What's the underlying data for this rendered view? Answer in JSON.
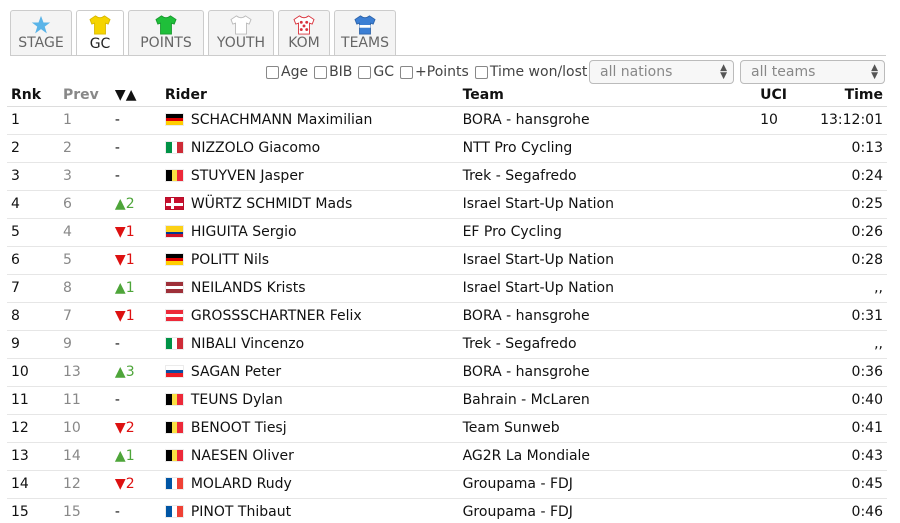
{
  "tabs": [
    {
      "label": "STAGE",
      "icon": "star-icon",
      "color": "#5ab4e8",
      "active": false
    },
    {
      "label": "GC",
      "icon": "yellow-jersey-icon",
      "color": "#f5d400",
      "active": true
    },
    {
      "label": "POINTS",
      "icon": "green-jersey-icon",
      "color": "#1fbf3a",
      "active": false
    },
    {
      "label": "YOUTH",
      "icon": "white-jersey-icon",
      "color": "#ffffff",
      "active": false
    },
    {
      "label": "KOM",
      "icon": "polka-dot-jersey-icon",
      "color": "#d9323c",
      "active": false
    },
    {
      "label": "TEAMS",
      "icon": "team-jersey-icon",
      "color": "#3c7fd4",
      "active": false
    }
  ],
  "filters": {
    "checkboxes": [
      "Age",
      "BIB",
      "GC",
      "+Points",
      "Time won/lost"
    ],
    "nations_select": "all nations",
    "teams_select": "all teams"
  },
  "table": {
    "headers": {
      "rnk": "Rnk",
      "prev": "Prev",
      "diff": "▼▲",
      "rider": "Rider",
      "team": "Team",
      "uci": "UCI",
      "time": "Time"
    },
    "rows": [
      {
        "rnk": "1",
        "prev": "1",
        "diff": "-",
        "dir": "",
        "flag": "de",
        "rider": "SCHACHMANN Maximilian",
        "team": "BORA - hansgrohe",
        "uci": "10",
        "time": "13:12:01"
      },
      {
        "rnk": "2",
        "prev": "2",
        "diff": "-",
        "dir": "",
        "flag": "it",
        "rider": "NIZZOLO Giacomo",
        "team": "NTT Pro Cycling",
        "uci": "",
        "time": "0:13"
      },
      {
        "rnk": "3",
        "prev": "3",
        "diff": "-",
        "dir": "",
        "flag": "be",
        "rider": "STUYVEN Jasper",
        "team": "Trek - Segafredo",
        "uci": "",
        "time": "0:24"
      },
      {
        "rnk": "4",
        "prev": "6",
        "diff": "▲2",
        "dir": "up",
        "flag": "dk",
        "rider": "WÜRTZ SCHMIDT Mads",
        "team": "Israel Start-Up Nation",
        "uci": "",
        "time": "0:25"
      },
      {
        "rnk": "5",
        "prev": "4",
        "diff": "▼1",
        "dir": "down",
        "flag": "co",
        "rider": "HIGUITA Sergio",
        "team": "EF Pro Cycling",
        "uci": "",
        "time": "0:26"
      },
      {
        "rnk": "6",
        "prev": "5",
        "diff": "▼1",
        "dir": "down",
        "flag": "de",
        "rider": "POLITT Nils",
        "team": "Israel Start-Up Nation",
        "uci": "",
        "time": "0:28"
      },
      {
        "rnk": "7",
        "prev": "8",
        "diff": "▲1",
        "dir": "up",
        "flag": "lv",
        "rider": "NEILANDS Krists",
        "team": "Israel Start-Up Nation",
        "uci": "",
        "time": ",,"
      },
      {
        "rnk": "8",
        "prev": "7",
        "diff": "▼1",
        "dir": "down",
        "flag": "at",
        "rider": "GROSSSCHARTNER Felix",
        "team": "BORA - hansgrohe",
        "uci": "",
        "time": "0:31"
      },
      {
        "rnk": "9",
        "prev": "9",
        "diff": "-",
        "dir": "",
        "flag": "it",
        "rider": "NIBALI Vincenzo",
        "team": "Trek - Segafredo",
        "uci": "",
        "time": ",,"
      },
      {
        "rnk": "10",
        "prev": "13",
        "diff": "▲3",
        "dir": "up",
        "flag": "sk",
        "rider": "SAGAN Peter",
        "team": "BORA - hansgrohe",
        "uci": "",
        "time": "0:36"
      },
      {
        "rnk": "11",
        "prev": "11",
        "diff": "-",
        "dir": "",
        "flag": "be",
        "rider": "TEUNS Dylan",
        "team": "Bahrain - McLaren",
        "uci": "",
        "time": "0:40"
      },
      {
        "rnk": "12",
        "prev": "10",
        "diff": "▼2",
        "dir": "down",
        "flag": "be",
        "rider": "BENOOT Tiesj",
        "team": "Team Sunweb",
        "uci": "",
        "time": "0:41"
      },
      {
        "rnk": "13",
        "prev": "14",
        "diff": "▲1",
        "dir": "up",
        "flag": "be",
        "rider": "NAESEN Oliver",
        "team": "AG2R La Mondiale",
        "uci": "",
        "time": "0:43"
      },
      {
        "rnk": "14",
        "prev": "12",
        "diff": "▼2",
        "dir": "down",
        "flag": "fr",
        "rider": "MOLARD Rudy",
        "team": "Groupama - FDJ",
        "uci": "",
        "time": "0:45"
      },
      {
        "rnk": "15",
        "prev": "15",
        "diff": "-",
        "dir": "",
        "flag": "fr",
        "rider": "PINOT Thibaut",
        "team": "Groupama - FDJ",
        "uci": "",
        "time": "0:46"
      }
    ]
  },
  "colors": {
    "up": "#4ea53a",
    "down": "#dd1111"
  }
}
